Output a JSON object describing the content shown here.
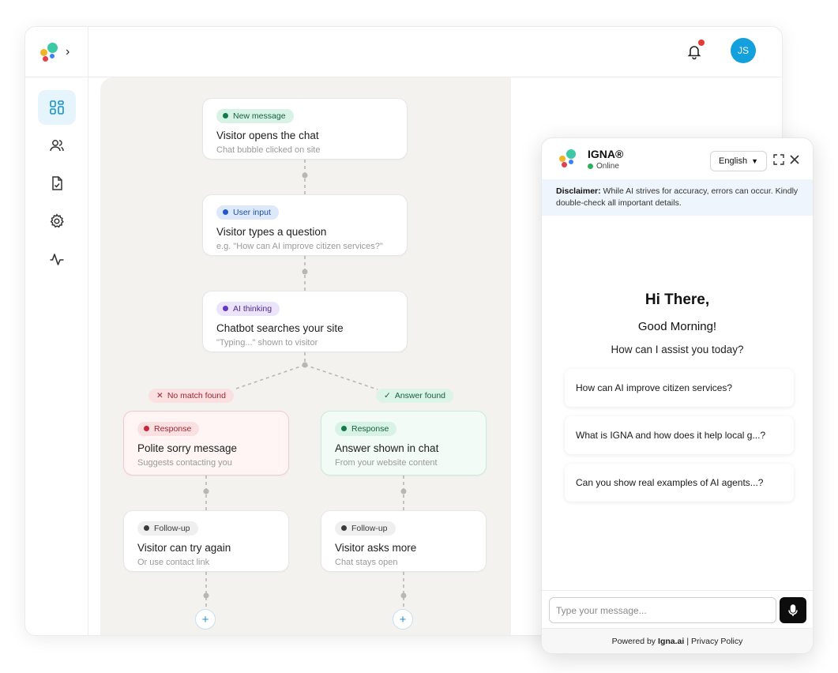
{
  "header": {
    "avatar_initials": "JS",
    "notification_dot_color": "#e53935"
  },
  "sidebar": {
    "items": [
      {
        "icon": "dashboard-icon",
        "active": true
      },
      {
        "icon": "users-icon",
        "active": false
      },
      {
        "icon": "document-check-icon",
        "active": false
      },
      {
        "icon": "gear-icon",
        "active": false
      },
      {
        "icon": "activity-icon",
        "active": false
      }
    ]
  },
  "flow": {
    "nodes": [
      {
        "tag": "New message",
        "title": "Visitor opens the chat",
        "sub": "Chat bubble clicked on site"
      },
      {
        "tag": "User input",
        "title": "Visitor types a question",
        "sub": "e.g. \"How can AI improve citizen services?\""
      },
      {
        "tag": "AI thinking",
        "title": "Chatbot searches your site",
        "sub": "\"Typing...\" shown to visitor"
      },
      {
        "tag": "Response",
        "title": "Polite sorry message",
        "sub": "Suggests contacting you"
      },
      {
        "tag": "Response",
        "title": "Answer shown in chat",
        "sub": "From your website content"
      },
      {
        "tag": "Follow-up",
        "title": "Visitor can try again",
        "sub": "Or use contact link"
      },
      {
        "tag": "Follow-up",
        "title": "Visitor asks more",
        "sub": "Chat stays open"
      }
    ],
    "branches": {
      "no_match": "No match found",
      "answer": "Answer found"
    },
    "add_symbol": "+"
  },
  "chat": {
    "name": "IGNA®",
    "status": "Online",
    "language": "English",
    "disclaimer_label": "Disclaimer:",
    "disclaimer_text": " While AI strives for accuracy, errors can occur. Kindly double-check all important details.",
    "greeting": "Hi There,",
    "subgreeting": "Good Morning!",
    "prompt": "How can I assist you today?",
    "suggestions": [
      "How can AI improve citizen services?",
      "What is IGNA and how does it help local g...?",
      "Can you show real examples of AI agents...?"
    ],
    "input_placeholder": "Type your message...",
    "powered_prefix": "Powered by",
    "powered_brand": "Igna.ai",
    "powered_sep": "|",
    "privacy": "Privacy Policy"
  }
}
